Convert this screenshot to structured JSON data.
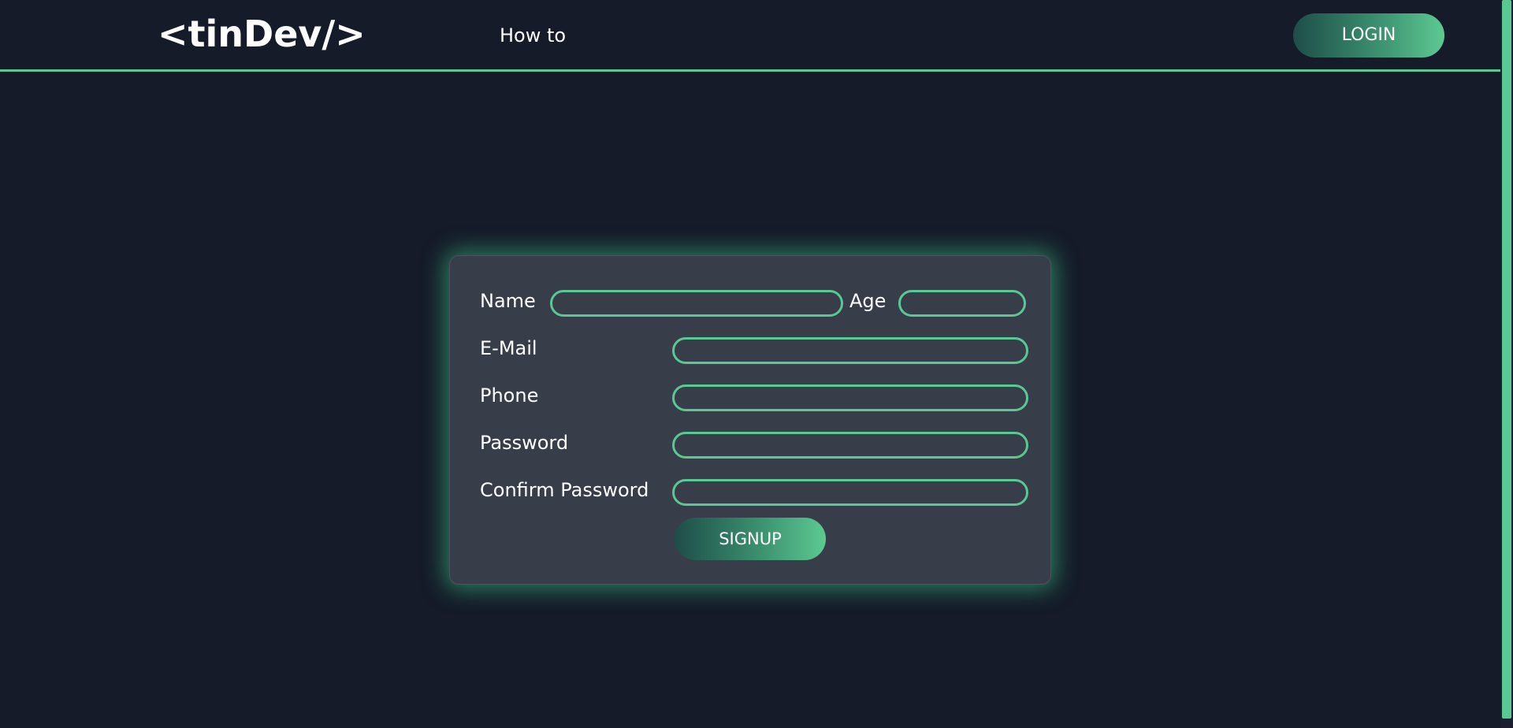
{
  "header": {
    "logo_text": "<tinDev/>",
    "nav_link": "How to",
    "login_label": "LOGIN"
  },
  "form": {
    "name_label": "Name",
    "age_label": "Age",
    "email_label": "E-Mail",
    "phone_label": "Phone",
    "password_label": "Password",
    "confirm_password_label": "Confirm Password",
    "name_value": "",
    "age_value": "",
    "email_value": "",
    "phone_value": "",
    "password_value": "",
    "confirm_password_value": "",
    "signup_label": "SIGNUP"
  },
  "colors": {
    "background": "#151b28",
    "card": "#383d4a",
    "accent": "#5ac892",
    "button_gradient_start": "#1e4d49",
    "button_gradient_end": "#5dc992"
  }
}
